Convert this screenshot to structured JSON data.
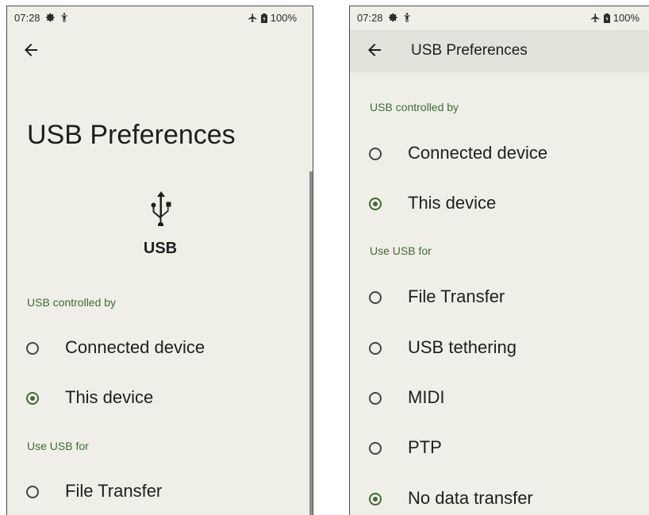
{
  "colors": {
    "background": "#f0efe7",
    "toolbar": "#e2e2da",
    "accent": "#3f6b37",
    "text": "#1e1e1e"
  },
  "left_screen": {
    "status": {
      "time": "07:28",
      "battery": "100%",
      "icons": [
        "gear-icon",
        "person-icon",
        "airplane-icon",
        "battery-icon"
      ]
    },
    "title": "USB Preferences",
    "device_label": "USB",
    "device_icon": "usb-icon",
    "sections": [
      {
        "header": "USB controlled by",
        "options": [
          {
            "label": "Connected device",
            "checked": false
          },
          {
            "label": "This device",
            "checked": true
          }
        ]
      },
      {
        "header": "Use USB for",
        "options": [
          {
            "label": "File Transfer",
            "checked": false
          }
        ]
      }
    ]
  },
  "right_screen": {
    "status": {
      "time": "07:28",
      "battery": "100%",
      "icons": [
        "gear-icon",
        "person-icon",
        "airplane-icon",
        "battery-icon"
      ]
    },
    "toolbar_title": "USB Preferences",
    "sections": [
      {
        "header": "USB controlled by",
        "options": [
          {
            "label": "Connected device",
            "checked": false
          },
          {
            "label": "This device",
            "checked": true
          }
        ]
      },
      {
        "header": "Use USB for",
        "options": [
          {
            "label": "File Transfer",
            "checked": false
          },
          {
            "label": "USB tethering",
            "checked": false
          },
          {
            "label": "MIDI",
            "checked": false
          },
          {
            "label": "PTP",
            "checked": false
          },
          {
            "label": "No data transfer",
            "checked": true
          }
        ]
      }
    ]
  }
}
